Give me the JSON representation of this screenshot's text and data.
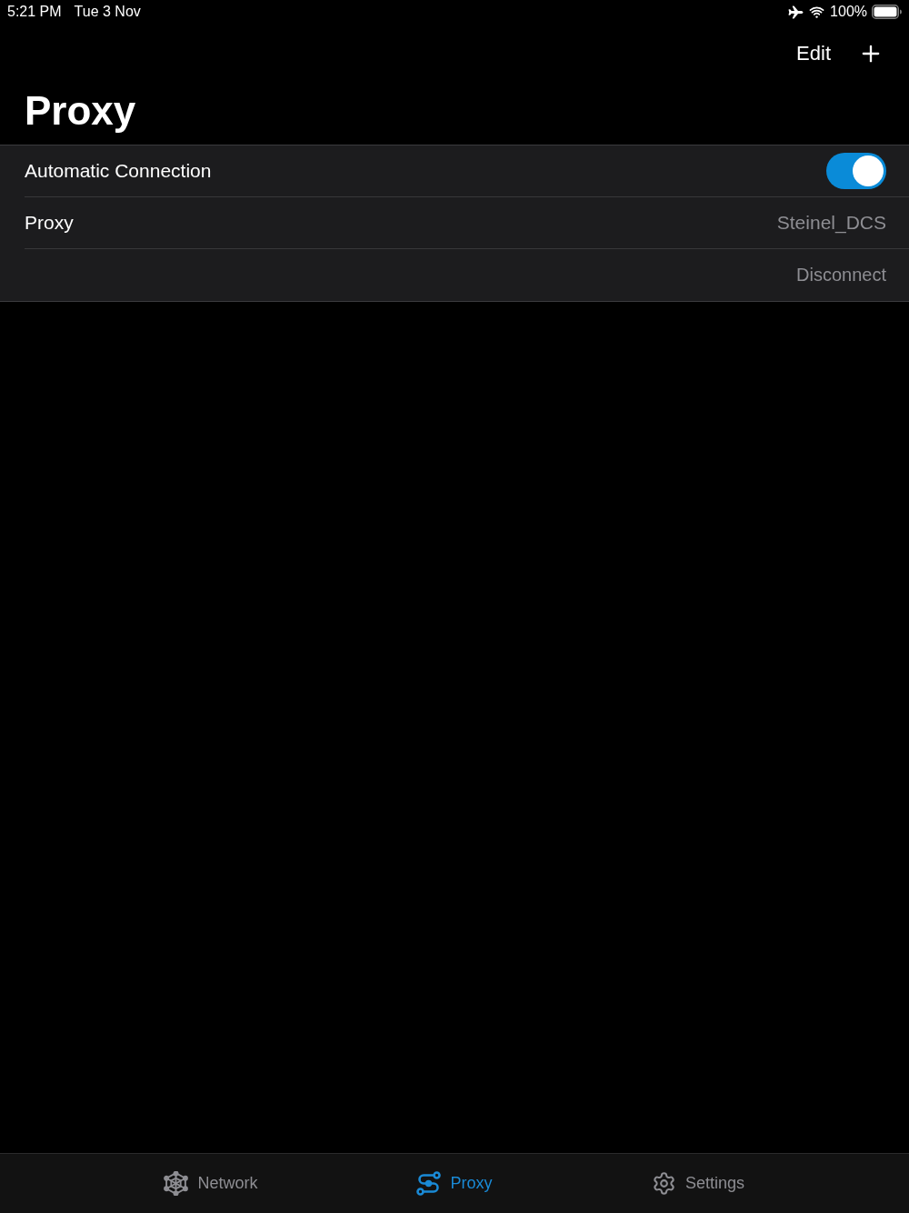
{
  "status_bar": {
    "time": "5:21 PM",
    "date": "Tue 3 Nov",
    "battery": "100%"
  },
  "nav_bar": {
    "edit": "Edit",
    "title": "Proxy"
  },
  "rows": [
    {
      "kind": "toggle",
      "label": "Automatic Connection",
      "on": true
    },
    {
      "kind": "value",
      "label": "Proxy",
      "value": "Steinel_DCS"
    },
    {
      "kind": "action",
      "label": "Disconnect"
    }
  ],
  "tab_bar": [
    {
      "label": "Network",
      "selected": false
    },
    {
      "label": "Proxy",
      "selected": true
    },
    {
      "label": "Settings",
      "selected": false
    }
  ]
}
